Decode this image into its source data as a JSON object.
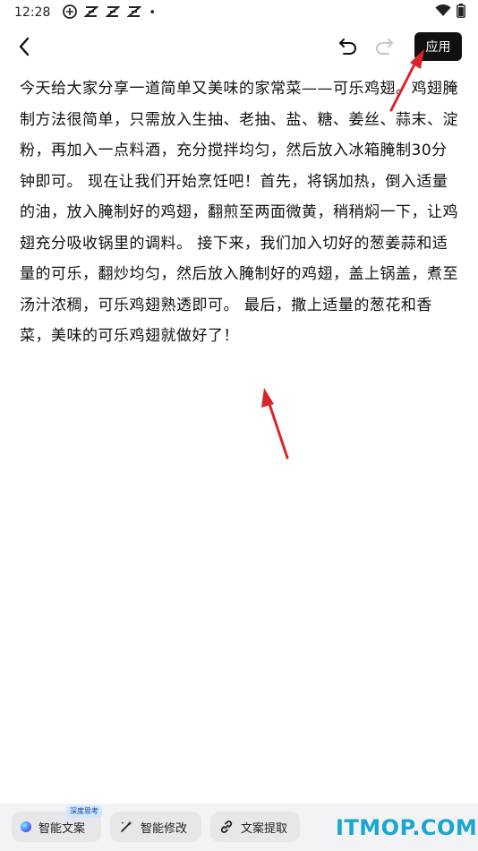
{
  "status_bar": {
    "time": "12:28",
    "left_icons": [
      "capcut-icon",
      "notification-icon",
      "notification-icon",
      "notification-icon"
    ],
    "dot": "•",
    "right_icons": [
      "wifi-icon",
      "battery-icon"
    ]
  },
  "toolbar": {
    "apply_label": "应用"
  },
  "content": {
    "text": "今天给大家分享一道简单又美味的家常菜——可乐鸡翅。鸡翅腌制方法很简单，只需放入生抽、老抽、盐、糖、姜丝、蒜末、淀粉，再加入一点料酒，充分搅拌均匀，然后放入冰箱腌制30分钟即可。 现在让我们开始烹饪吧！首先，将锅加热，倒入适量的油，放入腌制好的鸡翅，翻煎至两面微黄，稍稍焖一下，让鸡翅充分吸收锅里的调料。 接下来，我们加入切好的葱姜蒜和适量的可乐，翻炒均匀，然后放入腌制好的鸡翅，盖上锅盖，煮至汤汁浓稠，可乐鸡翅熟透即可。 最后，撒上适量的葱花和香菜，美味的可乐鸡翅就做好了！"
  },
  "bottom_bar": {
    "smart_copy_label": "智能文案",
    "deep_think_badge": "深度思考",
    "smart_edit_label": "智能修改",
    "extract_label": "文案提取"
  },
  "watermark": "ITMOP.COM",
  "colors": {
    "apply_bg": "#111111",
    "arrow": "#d9252a",
    "watermark": "#19a7cf"
  }
}
